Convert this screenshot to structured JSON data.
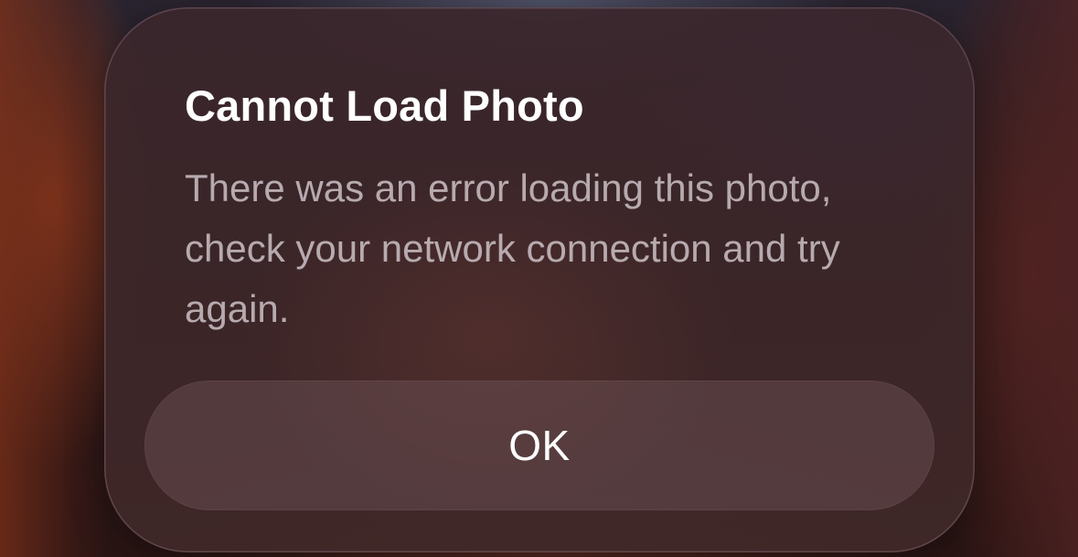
{
  "alert": {
    "title": "Cannot Load Photo",
    "message": "There was an error loading this photo, check your network connection and try again.",
    "ok_label": "OK"
  }
}
